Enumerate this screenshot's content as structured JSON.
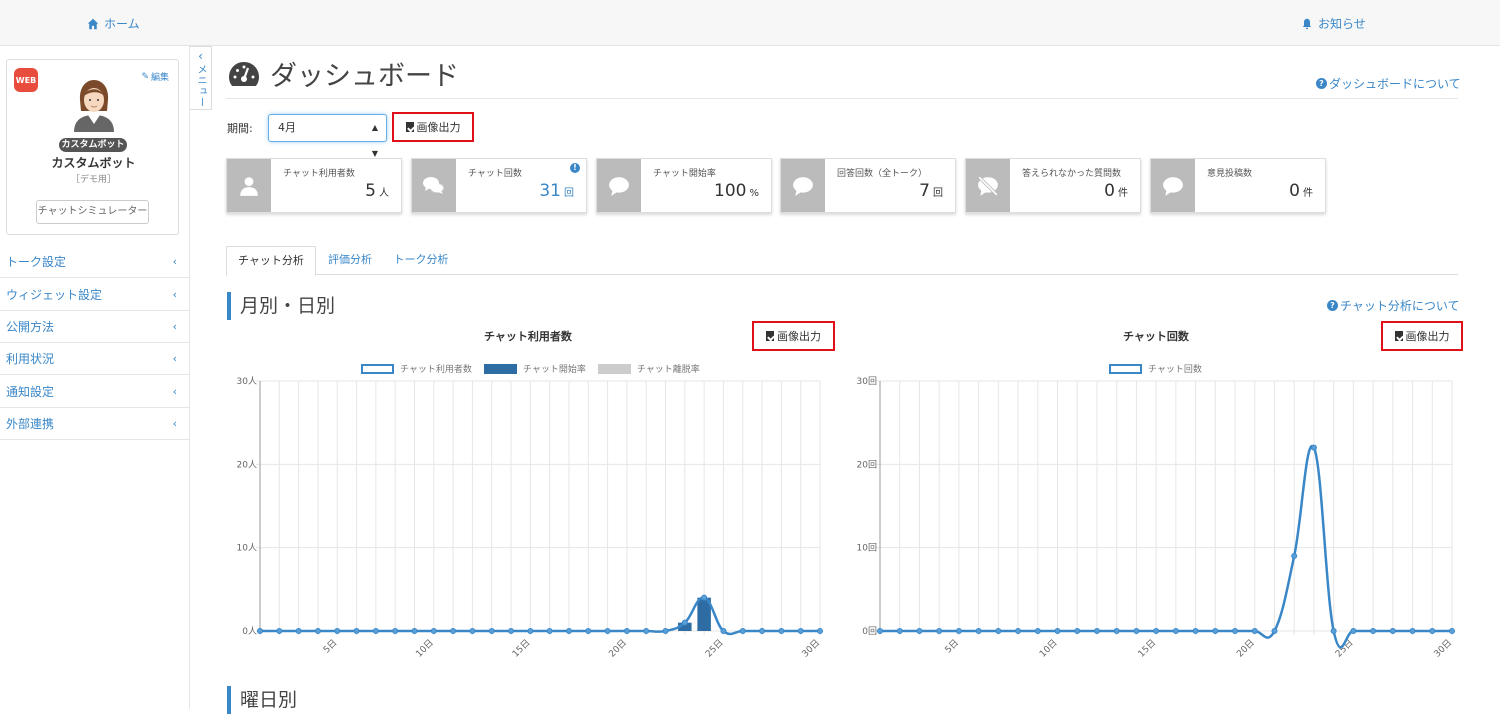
{
  "topbar": {
    "home": "ホーム",
    "notice": "お知らせ"
  },
  "profile": {
    "badge": "WEB",
    "edit": "編集",
    "tag": "カスタムボット",
    "name": "カスタムボット",
    "sub": "［デモ用］",
    "simulator": "チャットシミュレーター"
  },
  "sidebar": {
    "items": [
      {
        "label": "トーク設定"
      },
      {
        "label": "ウィジェット設定"
      },
      {
        "label": "公開方法"
      },
      {
        "label": "利用状況"
      },
      {
        "label": "通知設定"
      },
      {
        "label": "外部連携"
      }
    ],
    "collapse_label": "メニュー"
  },
  "header": {
    "title": "ダッシュボード",
    "help": "ダッシュボードについて"
  },
  "filter": {
    "label": "期間:",
    "period": "4月",
    "export": "画像出力"
  },
  "stats": [
    {
      "label": "チャット利用者数",
      "value": "5",
      "unit": "人",
      "icon": "user-icon",
      "highlight": false
    },
    {
      "label": "チャット回数",
      "value": "31",
      "unit": "回",
      "icon": "chat-bubbles-icon",
      "highlight": true
    },
    {
      "label": "チャット開始率",
      "value": "100",
      "unit": "%",
      "icon": "speech-bubble-icon",
      "highlight": false
    },
    {
      "label": "回答回数（全トーク）",
      "value": "7",
      "unit": "回",
      "icon": "comment-icon",
      "highlight": false
    },
    {
      "label": "答えられなかった質問数",
      "value": "0",
      "unit": "件",
      "icon": "no-comment-icon",
      "highlight": false
    },
    {
      "label": "意見投稿数",
      "value": "0",
      "unit": "件",
      "icon": "opinion-icon",
      "highlight": false
    }
  ],
  "tabs": [
    {
      "label": "チャット分析",
      "active": true
    },
    {
      "label": "評価分析",
      "active": false
    },
    {
      "label": "トーク分析",
      "active": false
    }
  ],
  "section1": {
    "title": "月別・日別",
    "help": "チャット分析について"
  },
  "section2": {
    "title": "曜日別"
  },
  "colors": {
    "accent": "#3a87c8",
    "highlight_border": "#e0101a",
    "card_icon_bg": "#bbbbbb"
  },
  "chart_data": [
    {
      "type": "bar",
      "title": "チャット利用者数",
      "export": "画像出力",
      "x": [
        1,
        2,
        3,
        4,
        5,
        6,
        7,
        8,
        9,
        10,
        11,
        12,
        13,
        14,
        15,
        16,
        17,
        18,
        19,
        20,
        21,
        22,
        23,
        24,
        25,
        26,
        27,
        28,
        29,
        30
      ],
      "xticks": [
        "5日",
        "10日",
        "15日",
        "20日",
        "25日",
        "30日"
      ],
      "yticks": [
        "0人",
        "10人",
        "20人",
        "30人"
      ],
      "ylim": [
        0,
        30
      ],
      "legend": [
        "チャット利用者数",
        "チャット開始率",
        "チャット離脱率"
      ],
      "series": [
        {
          "name": "チャット利用者数",
          "type": "line",
          "values": [
            0,
            0,
            0,
            0,
            0,
            0,
            0,
            0,
            0,
            0,
            0,
            0,
            0,
            0,
            0,
            0,
            0,
            0,
            0,
            0,
            0,
            0,
            1,
            4,
            0,
            0,
            0,
            0,
            0,
            0
          ]
        },
        {
          "name": "チャット開始率",
          "type": "bar",
          "values": [
            0,
            0,
            0,
            0,
            0,
            0,
            0,
            0,
            0,
            0,
            0,
            0,
            0,
            0,
            0,
            0,
            0,
            0,
            0,
            0,
            0,
            0,
            1,
            4,
            0,
            0,
            0,
            0,
            0,
            0
          ]
        },
        {
          "name": "チャット離脱率",
          "type": "bar",
          "values": [
            0,
            0,
            0,
            0,
            0,
            0,
            0,
            0,
            0,
            0,
            0,
            0,
            0,
            0,
            0,
            0,
            0,
            0,
            0,
            0,
            0,
            0,
            0,
            0,
            0,
            0,
            0,
            0,
            0,
            0
          ]
        }
      ]
    },
    {
      "type": "line",
      "title": "チャット回数",
      "export": "画像出力",
      "x": [
        1,
        2,
        3,
        4,
        5,
        6,
        7,
        8,
        9,
        10,
        11,
        12,
        13,
        14,
        15,
        16,
        17,
        18,
        19,
        20,
        21,
        22,
        23,
        24,
        25,
        26,
        27,
        28,
        29,
        30
      ],
      "xticks": [
        "5日",
        "10日",
        "15日",
        "20日",
        "25日",
        "30日"
      ],
      "yticks": [
        "0回",
        "10回",
        "20回",
        "30回"
      ],
      "ylim": [
        0,
        30
      ],
      "legend": [
        "チャット回数"
      ],
      "series": [
        {
          "name": "チャット回数",
          "values": [
            0,
            0,
            0,
            0,
            0,
            0,
            0,
            0,
            0,
            0,
            0,
            0,
            0,
            0,
            0,
            0,
            0,
            0,
            0,
            0,
            0,
            9,
            22,
            0,
            0,
            0,
            0,
            0,
            0,
            0
          ]
        }
      ]
    }
  ]
}
